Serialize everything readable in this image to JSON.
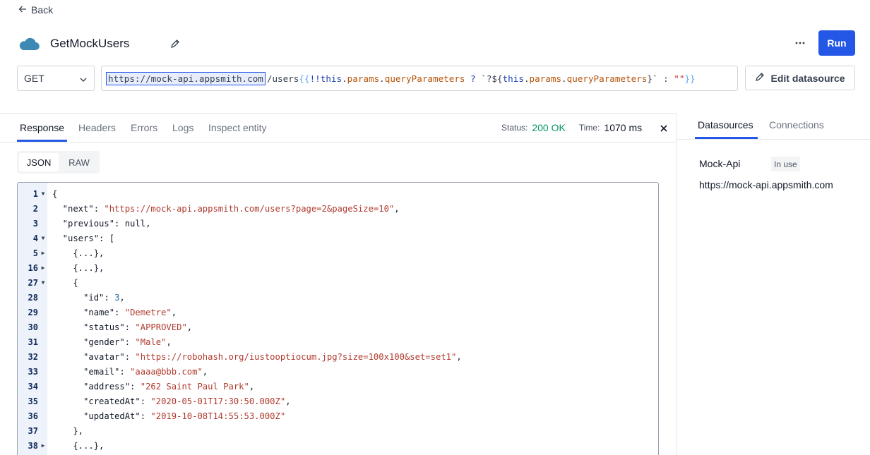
{
  "nav": {
    "back_label": "Back"
  },
  "api": {
    "name": "GetMockUsers",
    "run_label": "Run",
    "more_label": "···",
    "method": "GET",
    "url": {
      "base": "https://mock-api.appsmith.com",
      "path": "/users",
      "open_brace": "{{",
      "bang": "!!",
      "kw_this1": "this",
      "dot1": ".",
      "prop_params1": "params",
      "dot2": ".",
      "prop_query1": "queryParameters",
      "ternary": " ? ",
      "tpl_start": "`?${",
      "kw_this2": "this",
      "dot3": ".",
      "prop_params2": "params",
      "dot4": ".",
      "prop_query2": "queryParameters",
      "tpl_end": "}` : ",
      "empty_str": "\"\"",
      "close_brace": "}}"
    },
    "edit_datasource_label": "Edit datasource"
  },
  "response": {
    "tabs": [
      "Response",
      "Headers",
      "Errors",
      "Logs",
      "Inspect entity"
    ],
    "status_label": "Status:",
    "status_value": "200 OK",
    "time_label": "Time:",
    "time_value": "1070 ms",
    "formats": [
      "JSON",
      "RAW"
    ],
    "lines": [
      {
        "n": "1",
        "fold": "▼",
        "code": "{"
      },
      {
        "n": "2",
        "fold": "",
        "code": "  \"next\": ",
        "str": "\"https://mock-api.appsmith.com/users?page=2&pageSize=10\"",
        "tail": ","
      },
      {
        "n": "3",
        "fold": "",
        "code": "  \"previous\": null,"
      },
      {
        "n": "4",
        "fold": "▼",
        "code": "  \"users\": ["
      },
      {
        "n": "5",
        "fold": "▶",
        "code": "    {...},"
      },
      {
        "n": "16",
        "fold": "▶",
        "code": "    {...},"
      },
      {
        "n": "27",
        "fold": "▼",
        "code": "    {"
      },
      {
        "n": "28",
        "fold": "",
        "code": "      \"id\": ",
        "num": "3",
        "tail": ","
      },
      {
        "n": "29",
        "fold": "",
        "code": "      \"name\": ",
        "str": "\"Demetre\"",
        "tail": ","
      },
      {
        "n": "30",
        "fold": "",
        "code": "      \"status\": ",
        "str": "\"APPROVED\"",
        "tail": ","
      },
      {
        "n": "31",
        "fold": "",
        "code": "      \"gender\": ",
        "str": "\"Male\"",
        "tail": ","
      },
      {
        "n": "32",
        "fold": "",
        "code": "      \"avatar\": ",
        "str": "\"https://robohash.org/iustooptiocum.jpg?size=100x100&set=set1\"",
        "tail": ","
      },
      {
        "n": "33",
        "fold": "",
        "code": "      \"email\": ",
        "str": "\"aaaa@bbb.com\"",
        "tail": ","
      },
      {
        "n": "34",
        "fold": "",
        "code": "      \"address\": ",
        "str": "\"262 Saint Paul Park\"",
        "tail": ","
      },
      {
        "n": "35",
        "fold": "",
        "code": "      \"createdAt\": ",
        "str": "\"2020-05-01T17:30:50.000Z\"",
        "tail": ","
      },
      {
        "n": "36",
        "fold": "",
        "code": "      \"updatedAt\": ",
        "str": "\"2019-10-08T14:55:53.000Z\"",
        "tail": ""
      },
      {
        "n": "37",
        "fold": "",
        "code": "    },"
      },
      {
        "n": "38",
        "fold": "▶",
        "code": "    {...},"
      }
    ]
  },
  "datasources": {
    "tabs": [
      "Datasources",
      "Connections"
    ],
    "item_name": "Mock-Api",
    "item_badge": "In use",
    "item_url": "https://mock-api.appsmith.com"
  },
  "colors": {
    "accent": "#2457e5",
    "status_ok": "#059669",
    "string": "#b03a2e",
    "number": "#1f6fae"
  }
}
